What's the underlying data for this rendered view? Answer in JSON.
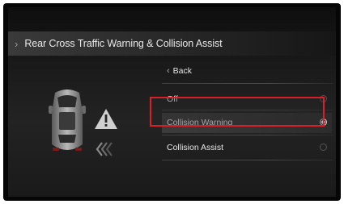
{
  "header": {
    "title": "Rear Cross Traffic Warning & Collision Assist"
  },
  "menu": {
    "back_label": "Back",
    "options": [
      {
        "label": "Off",
        "selected": false
      },
      {
        "label": "Collision Warning",
        "selected": true
      },
      {
        "label": "Collision Assist",
        "selected": false
      }
    ]
  },
  "colors": {
    "highlight_border": "#d8202b",
    "text": "#e6e6e6",
    "background": "#1a1a1a"
  },
  "icons": [
    "chevron-right-icon",
    "back-arrow-icon",
    "car-top-view-icon",
    "warning-triangle-icon",
    "rear-chevrons-icon"
  ]
}
